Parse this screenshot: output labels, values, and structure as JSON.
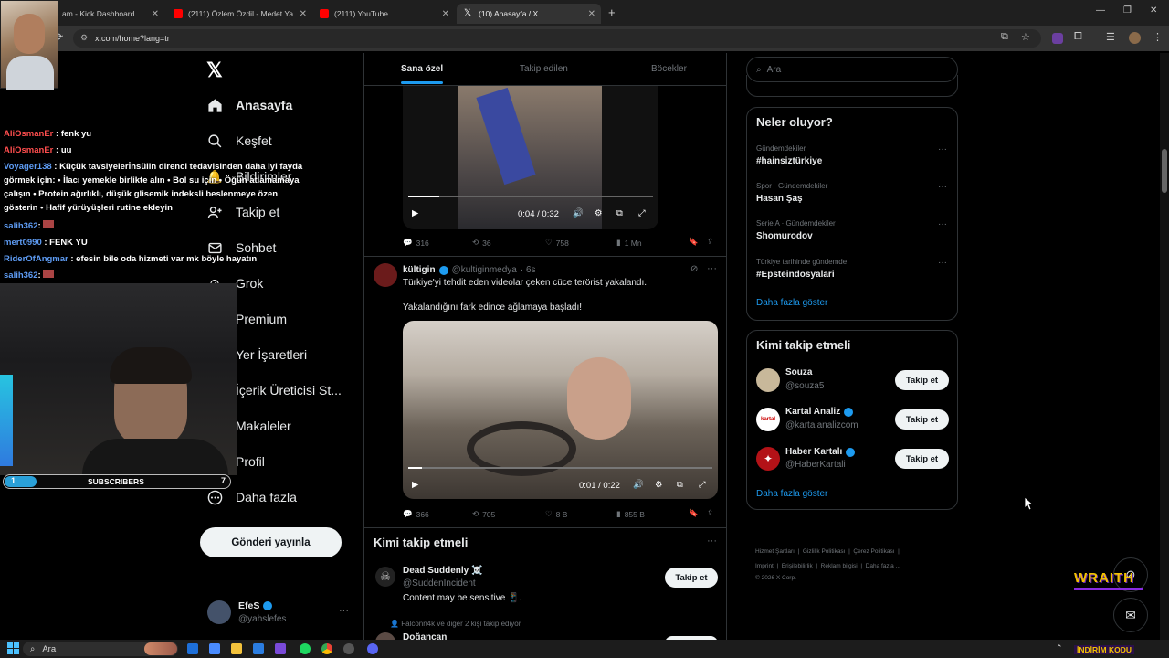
{
  "browser": {
    "tabs": [
      {
        "label": "am - Kick Dashboard"
      },
      {
        "label": "(2111) Özlem Özdil - Medet Ya"
      },
      {
        "label": "(2111) YouTube"
      },
      {
        "label": "(10) Anasayfa / X"
      }
    ],
    "url": "x.com/home?lang=tr"
  },
  "nav": {
    "items": [
      {
        "label": "Anasayfa"
      },
      {
        "label": "Keşfet"
      },
      {
        "label": "Bildirimler"
      },
      {
        "label": "Takip et"
      },
      {
        "label": "Sohbet"
      },
      {
        "label": "Grok"
      },
      {
        "label": "Premium"
      },
      {
        "label": "Yer İşaretleri"
      },
      {
        "label": "İçerik Üreticisi St..."
      },
      {
        "label": "Makaleler"
      },
      {
        "label": "Profil"
      },
      {
        "label": "Daha fazla"
      }
    ],
    "post_button": "Gönderi yayınla",
    "account": {
      "name": "EfeS",
      "handle": "@yahslefes"
    }
  },
  "feed": {
    "tabs": [
      "Sana özel",
      "Takip edilen",
      "Böcekler"
    ],
    "post1": {
      "video_time": "0:04 / 0:32",
      "progress": 0.125,
      "replies": "316",
      "reposts": "36",
      "likes": "758",
      "views": "1 Mn"
    },
    "post2": {
      "name": "kültigin",
      "handle": "@kultiginmedya",
      "time": "· 6s",
      "text1": "Türkiye'yi tehdit eden videolar çeken cüce terörist yakalandı.",
      "text2": "Yakalandığını fark edince ağlamaya başladı!",
      "video_time": "0:01 / 0:22",
      "progress": 0.045,
      "replies": "366",
      "reposts": "705",
      "likes": "8 B",
      "views": "855 B"
    },
    "who_to_follow": {
      "title": "Kimi takip etmeli",
      "user": {
        "name": "Dead Suddenly ☠️",
        "handle": "@SuddenIncident",
        "note": "Content may be sensitive",
        "button": "Takip et"
      },
      "social": "Falconn4k ve diğer 2 kişi takip ediyor",
      "next_name": "Doğancan"
    }
  },
  "right": {
    "search_placeholder": "Ara",
    "trends_title": "Neler oluyor?",
    "trends": [
      {
        "context": "Gündemdekiler",
        "topic": "#hainsiztürkiye"
      },
      {
        "context": "Spor · Gündemdekiler",
        "topic": "Hasan Şaş"
      },
      {
        "context": "Serie A · Gündemdekiler",
        "topic": "Shomurodov"
      },
      {
        "context": "Türkiye tarihinde gündemde",
        "topic": "#Epsteindosyalari"
      }
    ],
    "show_more": "Daha fazla göster",
    "follow_title": "Kimi takip etmeli",
    "follow": [
      {
        "name": "Souza",
        "handle": "@souza5",
        "button": "Takip et"
      },
      {
        "name": "Kartal Analiz",
        "handle": "@kartalanalizcom",
        "button": "Takip et"
      },
      {
        "name": "Haber Kartalı",
        "handle": "@HaberKartali",
        "button": "Takip et"
      }
    ],
    "footer1": "Hizmet Şartları  |  Gizlilik Politikası  |  Çerez Politikası  |",
    "footer2": "Imprint  |  Erişilebilirlik  |  Reklam bilgisi  |  Daha fazla ...",
    "footer3": "© 2026 X Corp."
  },
  "overlay": {
    "chat": [
      {
        "user": "AliOsmanEr",
        "msg": ": fenk yu",
        "color": "#ff4e4e"
      },
      {
        "user": "AliOsmanEr",
        "msg": ": uu",
        "color": "#ff4e4e"
      },
      {
        "user": "Voyager138",
        "msg": ": Küçük tavsiyelerİnsülin direnci tedavisinden daha iyi fayda görmek için: • İlacı yemekle birlikte alın • Bol su için • Öğün atlamamaya çalışın • Protein ağırlıklı, düşük glisemik indeksli beslenmeye özen gösterin • Hafif yürüyüşleri rutine ekleyin",
        "color": "#5e9cf4"
      },
      {
        "user": "salih362",
        "msg": ":",
        "color": "#5e9cf4"
      },
      {
        "user": "mert0990",
        "msg": ": FENK YU",
        "color": "#5e9cf4"
      },
      {
        "user": "RiderOfAngmar",
        "msg": ": efesin bile oda hizmeti var mk böyle hayatın",
        "color": "#5e9cf4"
      },
      {
        "user": "salih362",
        "msg": ":",
        "color": "#5e9cf4"
      }
    ],
    "subs_label": "SUBSCRIBERS",
    "subs_current": "1",
    "subs_goal": "7",
    "subs_progress": 0.14,
    "brand": "WRAITH",
    "ticker": "İNDİRİM KODU"
  },
  "taskbar": {
    "search": "Ara"
  }
}
